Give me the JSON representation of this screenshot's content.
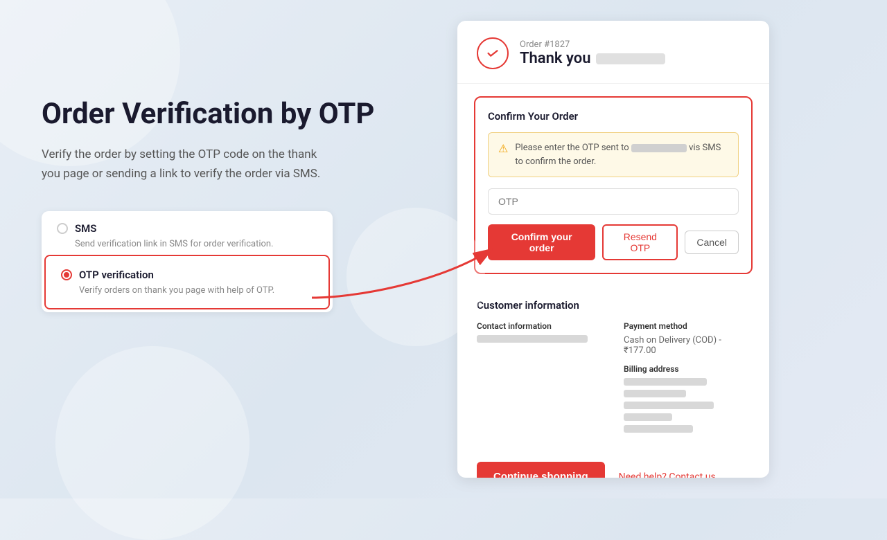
{
  "background": {
    "circles": [
      "circle1",
      "circle2",
      "circle3"
    ]
  },
  "left": {
    "title": "Order Verification by OTP",
    "subtitle": "Verify the order by setting the OTP code on the thank you page or sending a link to verify the order via SMS.",
    "options": [
      {
        "id": "sms",
        "label": "SMS",
        "description": "Send verification link in SMS for order verification.",
        "selected": false
      },
      {
        "id": "otp",
        "label": "OTP verification",
        "description": "Verify orders on thank you page with help of OTP.",
        "selected": true
      }
    ]
  },
  "right": {
    "order_number": "Order #1827",
    "thank_you_prefix": "Thank you",
    "confirm_section": {
      "title": "Confirm Your Order",
      "alert_text_before": "Please enter the OTP sent to",
      "alert_text_after": "vis SMS to confirm the order.",
      "otp_placeholder": "OTP",
      "confirm_button": "Confirm your order",
      "resend_button": "Resend OTP",
      "cancel_button": "Cancel"
    },
    "customer_section": {
      "title": "Customer information",
      "contact_label": "Contact information",
      "payment_label": "Payment method",
      "payment_value": "Cash on Delivery (COD) - ₹177.00",
      "billing_label": "Billing address"
    },
    "footer": {
      "continue_button": "Continue shopping",
      "help_link": "Need help? Contact us"
    }
  }
}
